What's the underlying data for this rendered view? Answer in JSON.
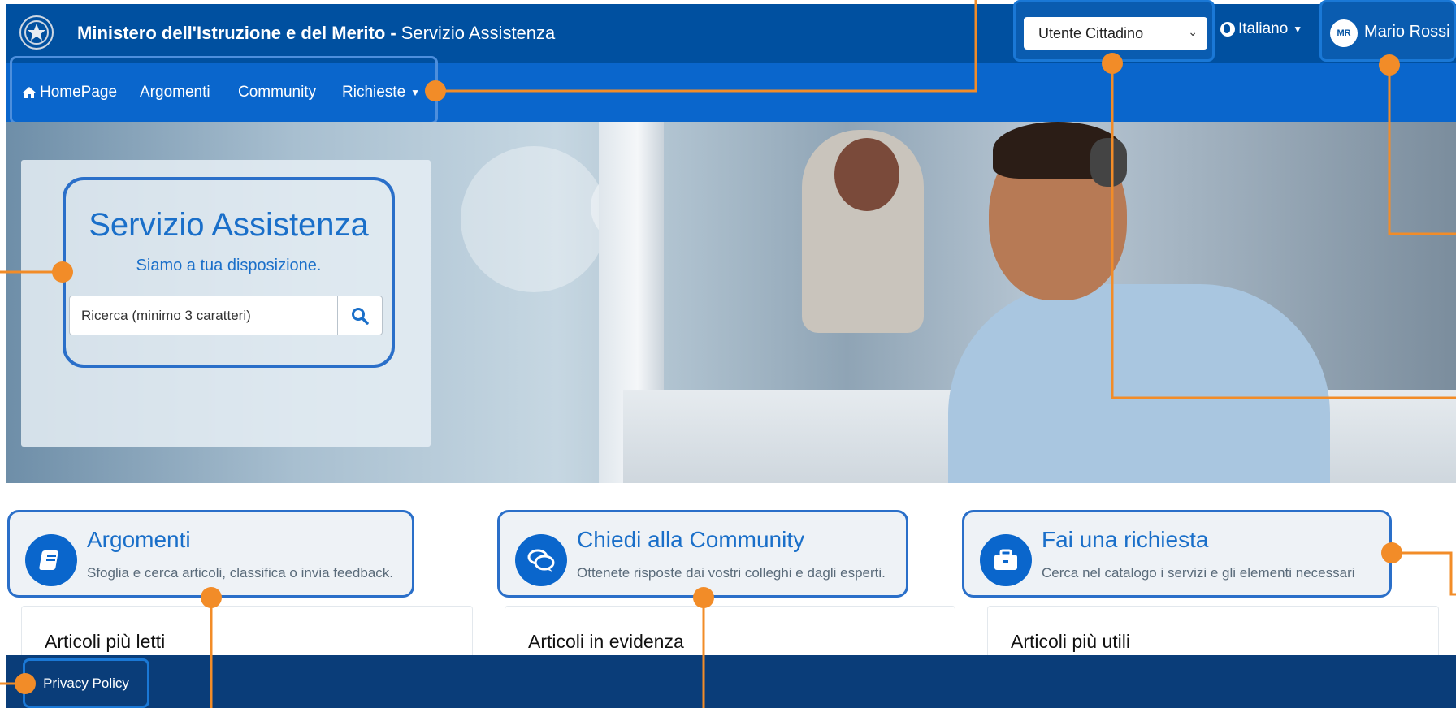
{
  "header": {
    "org_name": "Ministero dell'Istruzione e del Merito -",
    "service_name": "Servizio Assistenza",
    "role_selected": "Utente Cittadino",
    "language": "Italiano",
    "user_initials": "MR",
    "user_name": "Mario Rossi"
  },
  "nav": {
    "items": [
      {
        "label": "HomePage"
      },
      {
        "label": "Argomenti"
      },
      {
        "label": "Community"
      },
      {
        "label": "Richieste"
      }
    ]
  },
  "hero": {
    "title": "Servizio Assistenza",
    "subtitle": "Siamo a tua disposizione.",
    "search_placeholder": "Ricerca (minimo 3 caratteri)"
  },
  "cards": [
    {
      "title": "Argomenti",
      "description": "Sfoglia e cerca articoli, classifica o invia feedback.",
      "icon": "book-icon"
    },
    {
      "title": "Chiedi alla Community",
      "description": "Ottenete risposte dai vostri colleghi e dagli esperti.",
      "icon": "chat-icon"
    },
    {
      "title": "Fai una richiesta",
      "description": "Cerca nel catalogo i servizi e gli elementi necessari",
      "icon": "briefcase-icon"
    }
  ],
  "panels": [
    {
      "title": "Articoli più letti"
    },
    {
      "title": "Articoli in evidenza"
    },
    {
      "title": "Articoli più utili"
    }
  ],
  "footer": {
    "privacy_label": "Privacy Policy"
  },
  "colors": {
    "header_bg": "#0050a0",
    "nav_bg": "#0a66cc",
    "footer_bg": "#0a3d79",
    "accent": "#1a6fc9",
    "callout": "#f28c28"
  }
}
